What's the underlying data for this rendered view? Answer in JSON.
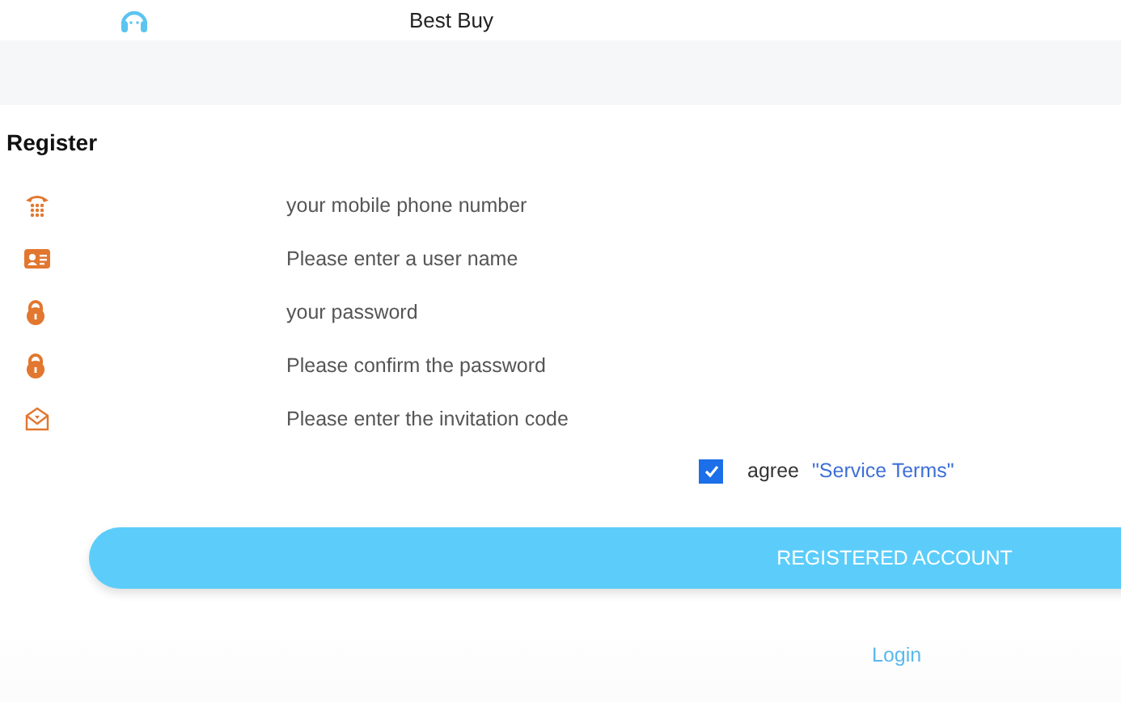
{
  "header": {
    "title": "Best Buy"
  },
  "form": {
    "title": "Register",
    "fields": [
      {
        "kind": "phone",
        "placeholder": "your mobile phone number"
      },
      {
        "kind": "card",
        "placeholder": "Please enter a user name"
      },
      {
        "kind": "lock",
        "placeholder": "your password"
      },
      {
        "kind": "lock",
        "placeholder": "Please confirm the password"
      },
      {
        "kind": "mail",
        "placeholder": "Please enter the invitation code"
      }
    ],
    "agree": {
      "checked": true,
      "label": "agree",
      "link": "\"Service Terms\""
    },
    "submit": "REGISTERED ACCOUNT",
    "login": "Login"
  }
}
